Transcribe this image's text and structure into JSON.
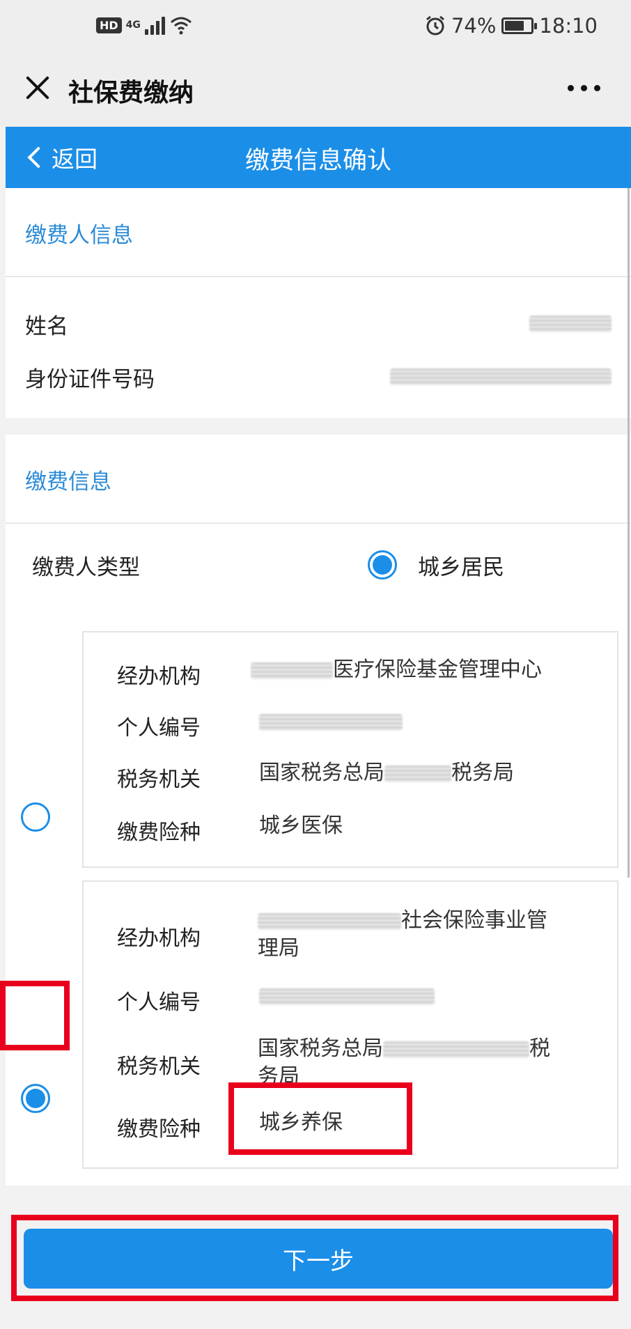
{
  "status_bar": {
    "hd": "HD",
    "network": "4G",
    "battery": "74%",
    "battery_level": 0.74,
    "time": "18:10",
    "icons": [
      "hd-icon",
      "signal-icon",
      "wifi-icon",
      "alarm-icon",
      "battery-icon"
    ]
  },
  "app_bar": {
    "title": "社保费缴纳"
  },
  "nav": {
    "back_label": "返回",
    "title": "缴费信息确认"
  },
  "payer_info": {
    "heading": "缴费人信息",
    "name_label": "姓名",
    "id_label": "身份证件号码"
  },
  "payment_info": {
    "heading": "缴费信息",
    "payer_type_label": "缴费人类型",
    "payer_type_value": "城乡居民"
  },
  "records": [
    {
      "agency_label": "经办机构",
      "agency_value": "医疗保险基金管理中心",
      "personal_no_label": "个人编号",
      "tax_label": "税务机关",
      "tax_prefix": "国家税务总局",
      "tax_suffix": "税务局",
      "insurance_label": "缴费险种",
      "insurance_value": "城乡医保",
      "selected": false
    },
    {
      "agency_label": "经办机构",
      "agency_value_line1": "社会保险事业管",
      "agency_value_line2": "理局",
      "personal_no_label": "个人编号",
      "tax_label": "税务机关",
      "tax_prefix": "国家税务总局",
      "tax_suffix_line1": "税",
      "tax_suffix_line2": "务局",
      "insurance_label": "缴费险种",
      "insurance_value": "城乡养保",
      "selected": true
    }
  ],
  "footer": {
    "next_label": "下一步"
  },
  "colors": {
    "accent": "#1b8ee8",
    "highlight": "#e8001c",
    "section_heading": "#2a8ad6"
  }
}
